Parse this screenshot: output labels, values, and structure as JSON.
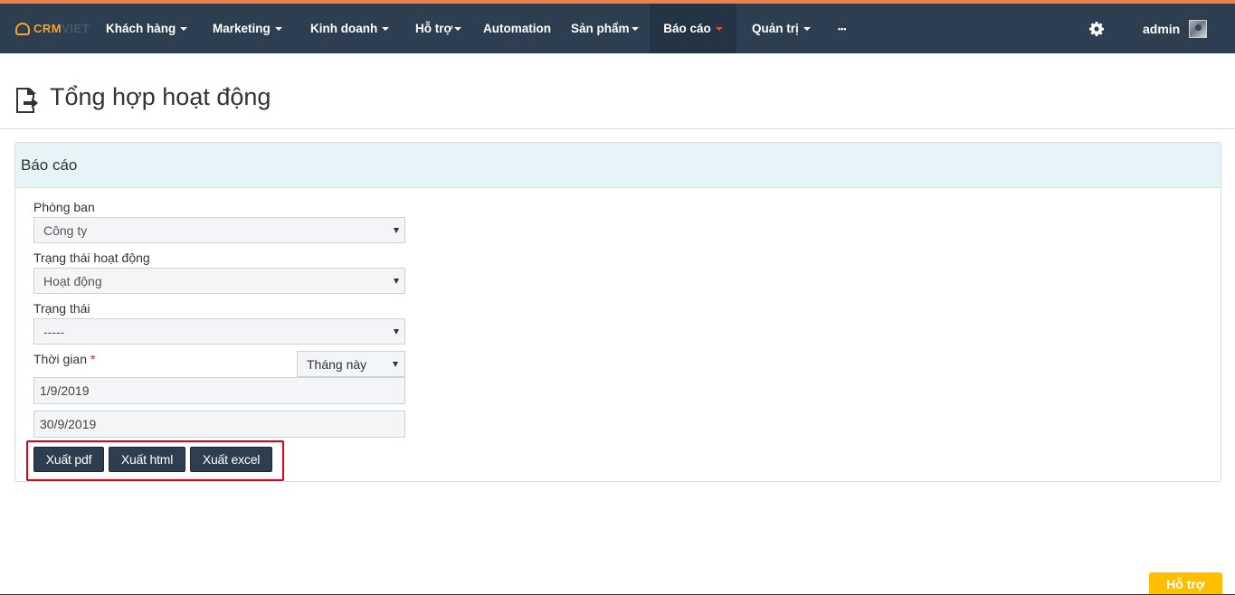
{
  "logo": {
    "part1": "CRM",
    "part2": "VIET"
  },
  "nav": {
    "items": [
      {
        "label": "Khách hàng"
      },
      {
        "label": "Marketing"
      },
      {
        "label": "Kinh doanh"
      },
      {
        "label": "Hỗ trợ"
      },
      {
        "label": "Automation"
      },
      {
        "label": "Sản phẩm"
      },
      {
        "label": "Báo cáo"
      },
      {
        "label": "Quản trị"
      },
      {
        "label": "•••"
      }
    ],
    "active": "Báo cáo",
    "settings_icon": "gear-icon",
    "user": "admin"
  },
  "page": {
    "title": "Tổng hợp hoạt động",
    "icon": "file-export-icon"
  },
  "panel": {
    "heading": "Báo cáo",
    "fields": {
      "department": {
        "label": "Phòng ban",
        "value": "Công ty"
      },
      "activity_status": {
        "label": "Trạng thái hoạt động",
        "value": "Hoạt động"
      },
      "status": {
        "label": "Trạng thái",
        "value": "-----"
      },
      "time": {
        "label": "Thời gian",
        "required_mark": "*",
        "period": "Tháng này",
        "from": "1/9/2019",
        "to": "30/9/2019"
      }
    },
    "buttons": {
      "pdf": "Xuất pdf",
      "html": "Xuất html",
      "excel": "Xuất excel"
    }
  },
  "help": {
    "label": "Hỗ trợ"
  },
  "colors": {
    "navbar": "#2d3e50",
    "accent": "#f07f4a",
    "highlight": "#e0001a",
    "help": "#ffbf00",
    "panel_head": "#e6f4f8"
  }
}
